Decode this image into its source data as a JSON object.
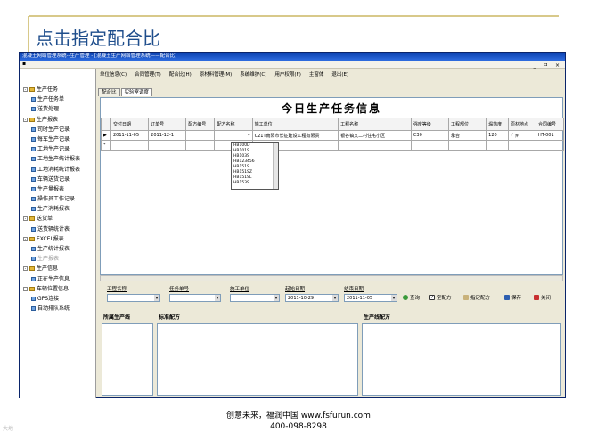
{
  "slide": {
    "title": "点击指定配合比",
    "footer_line1": "创意未来，福润中国 www.fsfurun.com",
    "footer_line2": "400-098-8298",
    "watermark": "大地"
  },
  "window": {
    "title": "混凝土网络管理系统--生产管理 - [混凝土生产网络管理系统——配合比]",
    "controls": "_ ㅁ ×"
  },
  "main_menu": [
    "单位信息(C)",
    "合同管理(T)",
    "配合比(H)",
    "原材料管理(M)",
    "系统维护(C)",
    "用户权限(F)",
    "主窗体",
    "退出(E)"
  ],
  "tabs": [
    "配合比",
    "实验室调度"
  ],
  "tree": [
    {
      "label": "生产任务",
      "indent": 0,
      "type": "folder",
      "expand": "-"
    },
    {
      "label": "生产任务单",
      "indent": 1,
      "type": "leaf"
    },
    {
      "label": "送货处理",
      "indent": 1,
      "type": "leaf"
    },
    {
      "label": "生产报表",
      "indent": 0,
      "type": "folder",
      "expand": "-"
    },
    {
      "label": "司时生产记录",
      "indent": 1,
      "type": "leaf"
    },
    {
      "label": "每车生产记录",
      "indent": 1,
      "type": "leaf"
    },
    {
      "label": "工地生产记录",
      "indent": 1,
      "type": "leaf"
    },
    {
      "label": "工地生产统计报表",
      "indent": 1,
      "type": "leaf"
    },
    {
      "label": "工地消耗统计报表",
      "indent": 1,
      "type": "leaf"
    },
    {
      "label": "车辆送货记录",
      "indent": 1,
      "type": "leaf"
    },
    {
      "label": "生产量报表",
      "indent": 1,
      "type": "leaf"
    },
    {
      "label": "操作员工作记录",
      "indent": 1,
      "type": "leaf"
    },
    {
      "label": "生产消耗报表",
      "indent": 1,
      "type": "leaf"
    },
    {
      "label": "送货单",
      "indent": 0,
      "type": "folder",
      "expand": "-"
    },
    {
      "label": "送货辆统计表",
      "indent": 1,
      "type": "leaf"
    },
    {
      "label": "EXCEL报表",
      "indent": 0,
      "type": "folder",
      "expand": "-"
    },
    {
      "label": "生产统计报表",
      "indent": 1,
      "type": "leaf"
    },
    {
      "label": "生产报表",
      "indent": 1,
      "type": "leaf",
      "grey": true
    },
    {
      "label": "生产信息",
      "indent": 0,
      "type": "folder",
      "expand": "-"
    },
    {
      "label": "正在生产信息",
      "indent": 1,
      "type": "leaf"
    },
    {
      "label": "车辆位置信息",
      "indent": 0,
      "type": "folder",
      "expand": "-"
    },
    {
      "label": "GPS连接",
      "indent": 1,
      "type": "leaf"
    },
    {
      "label": "自动排队系统",
      "indent": 1,
      "type": "leaf"
    }
  ],
  "grid": {
    "title": "今日生产任务信息",
    "columns": [
      "",
      "交付日期",
      "订单号",
      "配方编号",
      "配方名称",
      "施工单位",
      "工程名称",
      "强度等级",
      "工程部位",
      "塌落度",
      "原材地点",
      "合同编号"
    ],
    "rows": [
      [
        "▶",
        "2011-11-05",
        "2011-12-1",
        "",
        "▾",
        "C21T南阳市长征建设工程有限责",
        "银谷镇文二村住宅小区",
        "C30",
        "承台",
        "120",
        "广州",
        "HT-001"
      ],
      [
        "*",
        "",
        "",
        "",
        "",
        "",
        "",
        "",
        "",
        "",
        "",
        ""
      ]
    ],
    "dropdown_options": [
      "HB100D",
      "HB101S",
      "HB103S",
      "HB123456",
      "HB151S",
      "HB151SZ",
      "HB151SL",
      "HB153S"
    ]
  },
  "filters": {
    "project_name": "工程名称",
    "task_no": "任务单号",
    "construction_unit": "施工单位",
    "start_date_label": "起始日期",
    "start_date": "2011-10-29",
    "end_date_label": "结束日期",
    "end_date": "2011-11-05",
    "query": "查询",
    "empty_recipe": "空配方",
    "assign_recipe": "指定配方",
    "save": "保存",
    "close": "关闭"
  },
  "panels": {
    "line": "所属生产线",
    "standard": "标准配方",
    "production": "生产线配方"
  },
  "colors": {
    "title_blue": "#1f4e8c",
    "window_title": "#0a3fae",
    "gold_line": "#d8c98a"
  }
}
